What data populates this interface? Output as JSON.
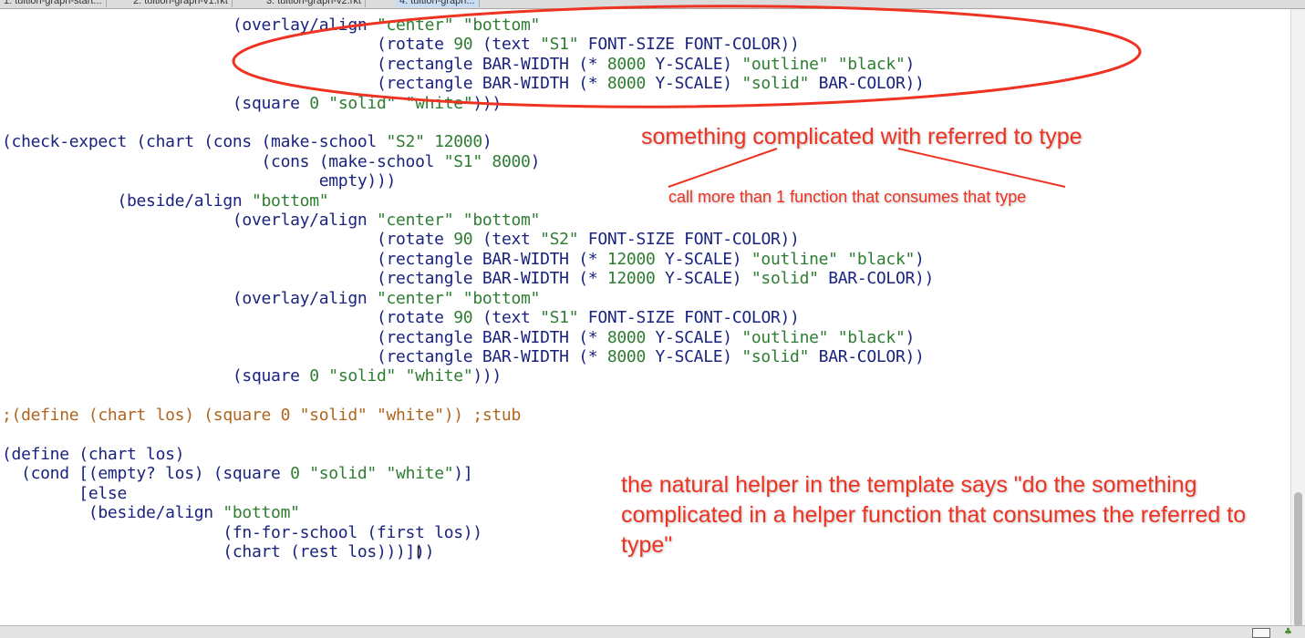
{
  "tabs": [
    {
      "label": "1: tuition-graph-start..."
    },
    {
      "label": "2: tuition-graph-v1.rkt"
    },
    {
      "label": "3: tuition-graph-v2.rkt"
    },
    {
      "label": "4: tuition-graph..."
    }
  ],
  "annotations": {
    "note1": "something complicated with referred to type",
    "note2": "call more than 1 function that consumes that type",
    "note3": "the natural helper in the template says \"do the something complicated in a helper function that consumes the referred to type\""
  },
  "colors": {
    "annotation": "#ee3322",
    "keyword": "#1a237e",
    "string": "#2e7d32",
    "comment": "#b0651e"
  },
  "icons": {
    "cursor": "ibeam-cursor-icon",
    "status": "gc-indicator-icon"
  },
  "cursor_glyph": "I",
  "status_glyph": "♣"
}
